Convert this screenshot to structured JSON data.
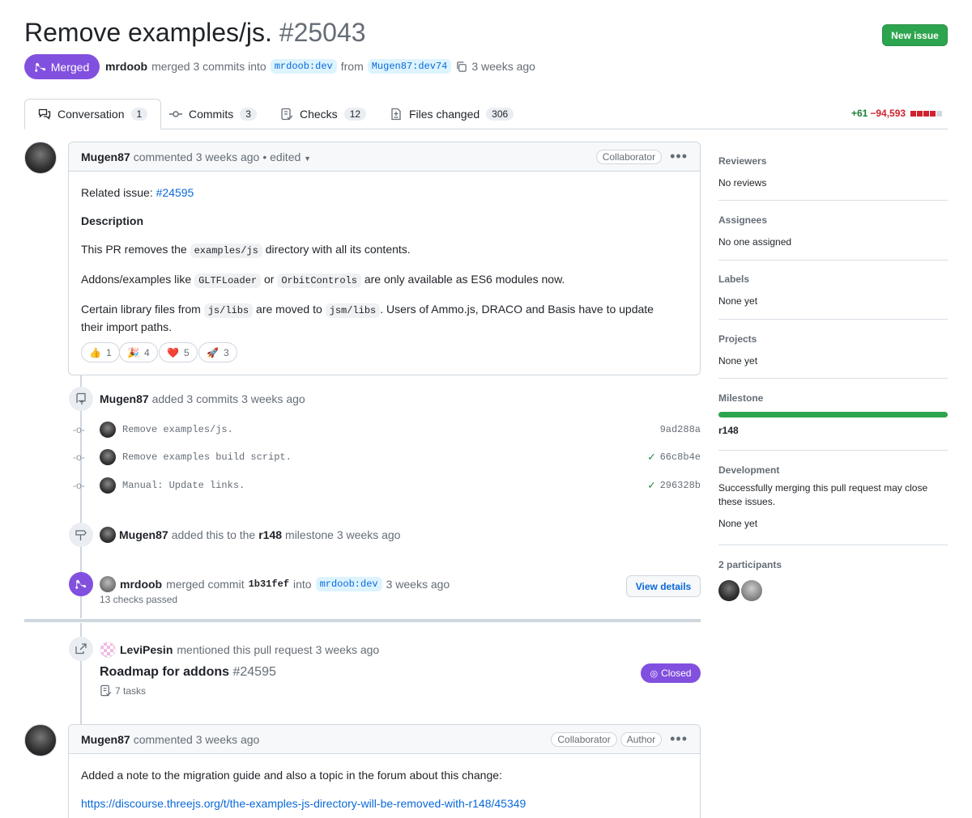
{
  "header": {
    "title": "Remove examples/js.",
    "number": "#25043",
    "new_issue_label": "New issue",
    "state_label": "Merged",
    "merger": "mrdoob",
    "merge_text": "merged 3 commits into",
    "base_branch": "mrdoob:dev",
    "from_text": "from",
    "head_branch": "Mugen87:dev74",
    "time": "3 weeks ago"
  },
  "tabs": [
    {
      "label": "Conversation",
      "count": "1",
      "icon": "comment-discussion-icon"
    },
    {
      "label": "Commits",
      "count": "3",
      "icon": "git-commit-icon"
    },
    {
      "label": "Checks",
      "count": "12",
      "icon": "checklist-icon"
    },
    {
      "label": "Files changed",
      "count": "306",
      "icon": "file-diff-icon"
    }
  ],
  "diffstat": {
    "additions": "+61",
    "deletions": "−94,593"
  },
  "comment1": {
    "author": "Mugen87",
    "action": "commented 3 weeks ago",
    "edited": "• edited",
    "role": "Collaborator",
    "related_label": "Related issue:",
    "related_link": "#24595",
    "heading": "Description",
    "p1_a": "This PR removes the",
    "p1_code": "examples/js",
    "p1_b": "directory with all its contents.",
    "p2_a": "Addons/examples like",
    "p2_code1": "GLTFLoader",
    "p2_or": "or",
    "p2_code2": "OrbitControls",
    "p2_b": "are only available as ES6 modules now.",
    "p3_a": "Certain library files from",
    "p3_code1": "js/libs",
    "p3_mid": "are moved to",
    "p3_code2": "jsm/libs",
    "p3_b": ". Users of Ammo.js, DRACO and Basis have to update their import paths.",
    "reactions": [
      {
        "emoji": "👍",
        "count": "1"
      },
      {
        "emoji": "🎉",
        "count": "4"
      },
      {
        "emoji": "❤️",
        "count": "5"
      },
      {
        "emoji": "🚀",
        "count": "3"
      }
    ]
  },
  "commits_event": {
    "author": "Mugen87",
    "text": "added 3 commits 3 weeks ago",
    "commits": [
      {
        "message": "Remove examples/js.",
        "sha": "9ad288a",
        "checked": false
      },
      {
        "message": "Remove examples build script.",
        "sha": "66c8b4e",
        "checked": true
      },
      {
        "message": "Manual: Update links.",
        "sha": "296328b",
        "checked": true
      }
    ]
  },
  "milestone_event": {
    "author": "Mugen87",
    "text_a": "added this to the",
    "milestone": "r148",
    "text_b": "milestone 3 weeks ago"
  },
  "merge_event": {
    "author": "mrdoob",
    "text_a": "merged commit",
    "sha": "1b31fef",
    "text_b": "into",
    "branch": "mrdoob:dev",
    "time": "3 weeks ago",
    "checks": "13 checks passed",
    "button": "View details"
  },
  "mention_event": {
    "author": "LeviPesin",
    "text": "mentioned this pull request 3 weeks ago",
    "issue_title": "Roadmap for addons",
    "issue_number": "#24595",
    "tasks": "7 tasks",
    "state": "Closed"
  },
  "comment2": {
    "author": "Mugen87",
    "action": "commented 3 weeks ago",
    "role": "Collaborator",
    "role2": "Author",
    "text": "Added a note to the migration guide and also a topic in the forum about this change:",
    "link": "https://discourse.threejs.org/t/the-examples-js-directory-will-be-removed-with-r148/45349"
  },
  "sidebar": {
    "reviewers_h": "Reviewers",
    "reviewers_v": "No reviews",
    "assignees_h": "Assignees",
    "assignees_v": "No one assigned",
    "labels_h": "Labels",
    "labels_v": "None yet",
    "projects_h": "Projects",
    "projects_v": "None yet",
    "milestone_h": "Milestone",
    "milestone_v": "r148",
    "milestone_progress": 1.0,
    "development_h": "Development",
    "development_text": "Successfully merging this pull request may close these issues.",
    "development_v": "None yet",
    "participants_h": "2 participants"
  },
  "colors": {
    "merged": "#8250df",
    "green": "#2da44e",
    "link": "#0969da",
    "danger": "#cf222e"
  }
}
